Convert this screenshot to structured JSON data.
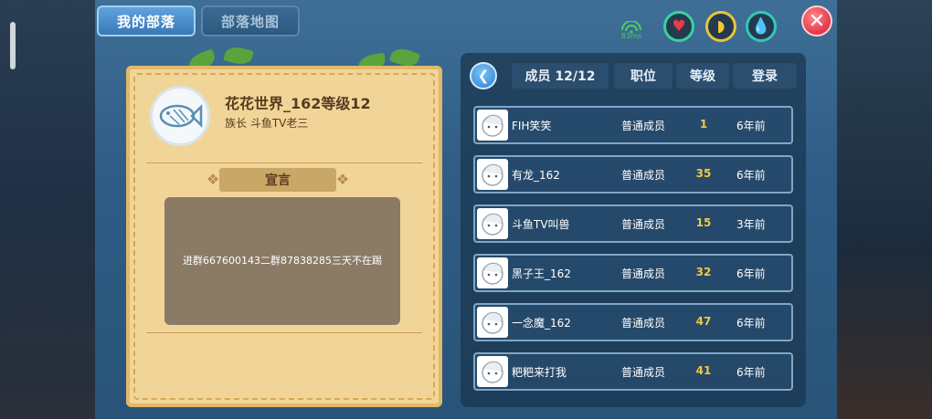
{
  "tabs": {
    "my_tribe": "我的部落",
    "tribe_map": "部落地图"
  },
  "status": {
    "signal": "83ms",
    "heart_icon": "heart-icon",
    "food_icon": "food-icon",
    "water_icon": "water-drop-icon",
    "close": "✕"
  },
  "tribe": {
    "name": "花花世界_162等级12",
    "leader": "族长 斗鱼TV老三",
    "declaration_title": "宣言",
    "declaration": "进群667600143二群87838285三天不在踢"
  },
  "members_panel": {
    "back": "❮",
    "headers": {
      "members": "成员 12/12",
      "position": "职位",
      "level": "等级",
      "login": "登录"
    },
    "rows": [
      {
        "name": "FIH笑笑",
        "role": "普通成员",
        "level": "1",
        "login": "6年前"
      },
      {
        "name": "有龙_162",
        "role": "普通成员",
        "level": "35",
        "login": "6年前"
      },
      {
        "name": "斗鱼TV叫兽",
        "role": "普通成员",
        "level": "15",
        "login": "3年前"
      },
      {
        "name": "黑子王_162",
        "role": "普通成员",
        "level": "32",
        "login": "6年前"
      },
      {
        "name": "一念魔_162",
        "role": "普通成员",
        "level": "47",
        "login": "6年前"
      },
      {
        "name": "粑粑来打我",
        "role": "普通成员",
        "level": "41",
        "login": "6年前"
      }
    ]
  },
  "colors": {
    "accent_blue": "#3a78b8",
    "parchment": "#f1d598",
    "level_gold": "#f2c940",
    "close_red": "#e4354a"
  }
}
